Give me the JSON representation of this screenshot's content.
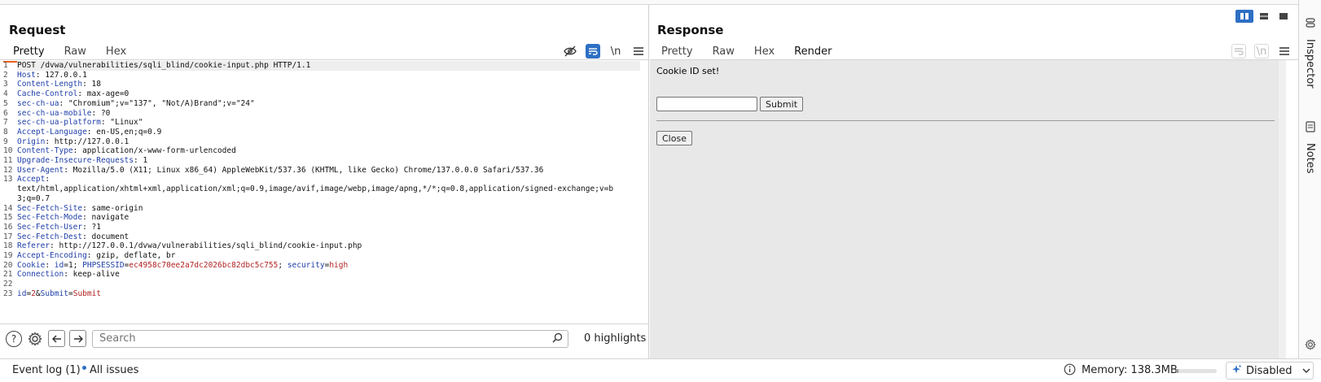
{
  "request": {
    "title": "Request",
    "tabs": [
      "Pretty",
      "Raw",
      "Hex"
    ],
    "active_tab": "Pretty",
    "newline_label": "\\n",
    "lines": [
      {
        "n": "1",
        "parts": [
          {
            "t": "POST /dvwa/vulnerabilities/sqli_blind/cookie-input.php HTTP/1.1",
            "c": ""
          }
        ]
      },
      {
        "n": "2",
        "parts": [
          {
            "t": "Host",
            "c": "k"
          },
          {
            "t": ": 127.0.0.1",
            "c": ""
          }
        ]
      },
      {
        "n": "3",
        "parts": [
          {
            "t": "Content-Length",
            "c": "k"
          },
          {
            "t": ": 18",
            "c": ""
          }
        ]
      },
      {
        "n": "4",
        "parts": [
          {
            "t": "Cache-Control",
            "c": "k"
          },
          {
            "t": ": max-age=0",
            "c": ""
          }
        ]
      },
      {
        "n": "5",
        "parts": [
          {
            "t": "sec-ch-ua",
            "c": "k"
          },
          {
            "t": ": \"Chromium\";v=\"137\", \"Not/A)Brand\";v=\"24\"",
            "c": ""
          }
        ]
      },
      {
        "n": "6",
        "parts": [
          {
            "t": "sec-ch-ua-mobile",
            "c": "k"
          },
          {
            "t": ": ?0",
            "c": ""
          }
        ]
      },
      {
        "n": "7",
        "parts": [
          {
            "t": "sec-ch-ua-platform",
            "c": "k"
          },
          {
            "t": ": \"Linux\"",
            "c": ""
          }
        ]
      },
      {
        "n": "8",
        "parts": [
          {
            "t": "Accept-Language",
            "c": "k"
          },
          {
            "t": ": en-US,en;q=0.9",
            "c": ""
          }
        ]
      },
      {
        "n": "9",
        "parts": [
          {
            "t": "Origin",
            "c": "k"
          },
          {
            "t": ": http://127.0.0.1",
            "c": ""
          }
        ]
      },
      {
        "n": "10",
        "parts": [
          {
            "t": "Content-Type",
            "c": "k"
          },
          {
            "t": ": application/x-www-form-urlencoded",
            "c": ""
          }
        ]
      },
      {
        "n": "11",
        "parts": [
          {
            "t": "Upgrade-Insecure-Requests",
            "c": "k"
          },
          {
            "t": ": 1",
            "c": ""
          }
        ]
      },
      {
        "n": "12",
        "parts": [
          {
            "t": "User-Agent",
            "c": "k"
          },
          {
            "t": ": Mozilla/5.0 (X11; Linux x86_64) AppleWebKit/537.36 (KHTML, like Gecko) Chrome/137.0.0.0 Safari/537.36",
            "c": ""
          }
        ]
      },
      {
        "n": "13",
        "parts": [
          {
            "t": "Accept",
            "c": "k"
          },
          {
            "t": ":",
            "c": ""
          }
        ]
      },
      {
        "n": "",
        "parts": [
          {
            "t": "text/html,application/xhtml+xml,application/xml;q=0.9,image/avif,image/webp,image/apng,*/*;q=0.8,application/signed-exchange;v=b",
            "c": ""
          }
        ]
      },
      {
        "n": "",
        "parts": [
          {
            "t": "3;q=0.7",
            "c": ""
          }
        ]
      },
      {
        "n": "14",
        "parts": [
          {
            "t": "Sec-Fetch-Site",
            "c": "k"
          },
          {
            "t": ": same-origin",
            "c": ""
          }
        ]
      },
      {
        "n": "15",
        "parts": [
          {
            "t": "Sec-Fetch-Mode",
            "c": "k"
          },
          {
            "t": ": navigate",
            "c": ""
          }
        ]
      },
      {
        "n": "16",
        "parts": [
          {
            "t": "Sec-Fetch-User",
            "c": "k"
          },
          {
            "t": ": ?1",
            "c": ""
          }
        ]
      },
      {
        "n": "17",
        "parts": [
          {
            "t": "Sec-Fetch-Dest",
            "c": "k"
          },
          {
            "t": ": document",
            "c": ""
          }
        ]
      },
      {
        "n": "18",
        "parts": [
          {
            "t": "Referer",
            "c": "k"
          },
          {
            "t": ": http://127.0.0.1/dvwa/vulnerabilities/sqli_blind/cookie-input.php",
            "c": ""
          }
        ]
      },
      {
        "n": "19",
        "parts": [
          {
            "t": "Accept-Encoding",
            "c": "k"
          },
          {
            "t": ": gzip, deflate, br",
            "c": ""
          }
        ]
      },
      {
        "n": "20",
        "parts": [
          {
            "t": "Cookie",
            "c": "k"
          },
          {
            "t": ": ",
            "c": ""
          },
          {
            "t": "id",
            "c": "k"
          },
          {
            "t": "=1; ",
            "c": ""
          },
          {
            "t": "PHPSESSID",
            "c": "k"
          },
          {
            "t": "=",
            "c": ""
          },
          {
            "t": "ec4958c70ee2a7dc2026bc82dbc5c755",
            "c": "v"
          },
          {
            "t": "; ",
            "c": ""
          },
          {
            "t": "security",
            "c": "k"
          },
          {
            "t": "=",
            "c": ""
          },
          {
            "t": "high",
            "c": "v"
          }
        ]
      },
      {
        "n": "21",
        "parts": [
          {
            "t": "Connection",
            "c": "k"
          },
          {
            "t": ": keep-alive",
            "c": ""
          }
        ]
      },
      {
        "n": "22",
        "parts": [
          {
            "t": "",
            "c": ""
          }
        ]
      },
      {
        "n": "23",
        "parts": [
          {
            "t": "id",
            "c": "k"
          },
          {
            "t": "=",
            "c": ""
          },
          {
            "t": "2",
            "c": "v"
          },
          {
            "t": "&",
            "c": ""
          },
          {
            "t": "Submit",
            "c": "k"
          },
          {
            "t": "=",
            "c": ""
          },
          {
            "t": "Submit",
            "c": "v"
          }
        ]
      }
    ],
    "search_placeholder": "Search",
    "highlights": "0 highlights"
  },
  "response": {
    "title": "Response",
    "tabs": [
      "Pretty",
      "Raw",
      "Hex",
      "Render"
    ],
    "active_tab": "Render",
    "newline_label": "\\n",
    "render": {
      "message": "Cookie ID set!",
      "input_value": "",
      "submit_label": "Submit",
      "close_label": "Close"
    }
  },
  "sidebar": {
    "inspector_label": "Inspector",
    "notes_label": "Notes"
  },
  "status": {
    "event_log": "Event log (1)",
    "all_issues": "All issues",
    "memory": "Memory: 138.3MB",
    "memory_usage_fraction": 0.06,
    "ai_state": "Disabled"
  },
  "colors": {
    "accent_orange": "#e8611a",
    "accent_blue": "#2e6fc4",
    "header_key": "#1f3fa8",
    "value_red": "#b22222"
  },
  "icons": [
    "hide-icon",
    "wrap-icon",
    "newline-icon",
    "menu-icon",
    "help-icon",
    "settings-icon",
    "back-arrow-icon",
    "forward-arrow-icon",
    "search-icon",
    "layout-split-icon",
    "layout-horizontal-icon",
    "layout-single-icon",
    "inspector-icon",
    "notes-icon",
    "info-icon",
    "sparkle-icon",
    "chevron-down-icon"
  ]
}
